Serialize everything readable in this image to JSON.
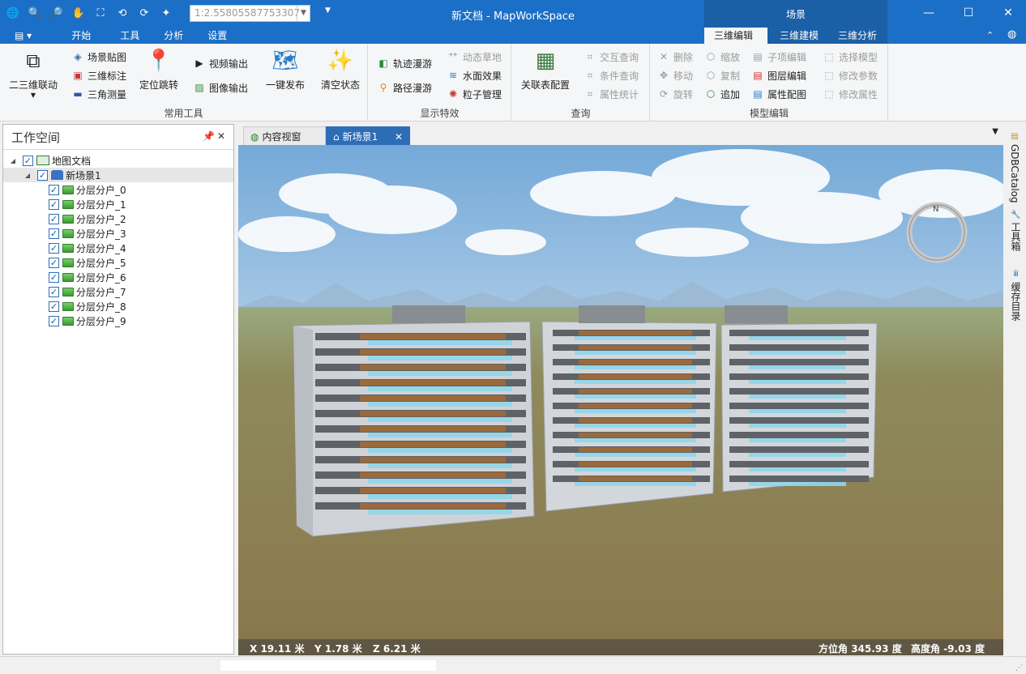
{
  "app": {
    "title": "新文档 - MapWorkSpace",
    "scale_value": "1:2.55805587753307"
  },
  "quick_access": [
    "globe-icon",
    "zoom-in-icon",
    "zoom-out-icon",
    "pan-hand-icon",
    "full-extent-icon",
    "rotate-left-icon",
    "rotate-right-icon",
    "magic-wand-icon"
  ],
  "context_tab_group": {
    "label": "场景"
  },
  "menu_tabs": [
    {
      "label": "开始"
    },
    {
      "label": "工具"
    },
    {
      "label": "分析"
    },
    {
      "label": "设置"
    },
    {
      "label": "三维编辑",
      "active": true
    },
    {
      "label": "三维建模"
    },
    {
      "label": "三维分析"
    }
  ],
  "ribbon": {
    "groups": {
      "common_tools": "常用工具",
      "display_effects": "显示特效",
      "query": "查询",
      "model_edit": "模型编辑"
    },
    "linkage": "二三维联动",
    "scene_texture": "场景贴图",
    "annotation_3d": "三维标注",
    "triangle_measure": "三角测量",
    "locate_jump": "定位跳转",
    "video_output": "视频输出",
    "image_output": "图像输出",
    "one_click_publish": "一键发布",
    "clear_state": "清空状态",
    "track_roam": "轨迹漫游",
    "path_roam": "路径漫游",
    "dynamic_grass": "动态草地",
    "water_effect": "水面效果",
    "particle_mgmt": "粒子管理",
    "link_table_config": "关联表配置",
    "interactive_query": "交互查询",
    "condition_query": "条件查询",
    "attribute_stats": "属性统计",
    "delete": "删除",
    "move": "移动",
    "rotate": "旋转",
    "scale": "缩放",
    "copy": "复制",
    "append": "追加",
    "subitem_edit": "子项编辑",
    "layer_edit": "图层编辑",
    "attribute_map": "属性配图",
    "select_model": "选择模型",
    "modify_params": "修改参数",
    "modify_attrs": "修改属性"
  },
  "workspace": {
    "title": "工作空间",
    "pin_icon": "pin-icon",
    "tree": {
      "root": "地图文档",
      "scene": "新场景1",
      "layers": [
        "分层分户_0",
        "分层分户_1",
        "分层分户_2",
        "分层分户_3",
        "分层分户_4",
        "分层分户_5",
        "分层分户_6",
        "分层分户_7",
        "分层分户_8",
        "分层分户_9"
      ]
    }
  },
  "doc_tabs": [
    {
      "label": "内容视窗",
      "active": false
    },
    {
      "label": "新场景1",
      "active": true
    }
  ],
  "status3d": {
    "x_label": "X",
    "x_value": "19.11",
    "x_unit": "米",
    "y_label": "Y",
    "y_value": "1.78",
    "y_unit": "米",
    "z_label": "Z",
    "z_value": "6.21",
    "z_unit": "米",
    "azimuth_label": "方位角",
    "azimuth_value": "345.93",
    "azimuth_unit": "度",
    "elevation_label": "高度角",
    "elevation_value": "-9.03",
    "elevation_unit": "度"
  },
  "right_tabs": [
    {
      "label": "GDBCatalog"
    },
    {
      "label": "工具箱"
    },
    {
      "label": "缓存目录"
    }
  ],
  "colors": {
    "titlebar": "#1c6fc6",
    "context_header": "#1b5fa6",
    "active_doc_tab": "#2d6db5"
  }
}
